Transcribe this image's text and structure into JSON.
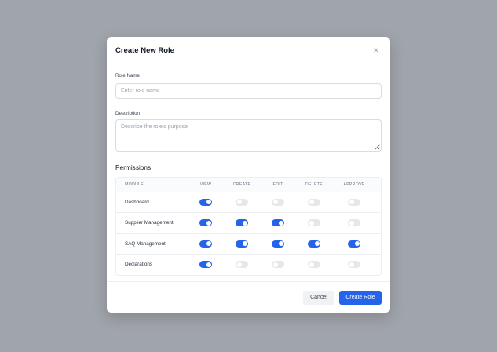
{
  "modal": {
    "title": "Create New Role",
    "close_icon": "×"
  },
  "form": {
    "role_name_label": "Role Name",
    "role_name_placeholder": "Enter role name",
    "role_name_value": "",
    "description_label": "Description",
    "description_placeholder": "Describe the role's purpose",
    "description_value": ""
  },
  "permissions": {
    "title": "Permissions",
    "columns": [
      "MODULE",
      "VIEW",
      "CREATE",
      "EDIT",
      "DELETE",
      "APPROVE"
    ],
    "rows": [
      {
        "module": "Dashboard",
        "view": true,
        "create": false,
        "edit": false,
        "delete": false,
        "approve": false
      },
      {
        "module": "Supplier Management",
        "view": true,
        "create": true,
        "edit": true,
        "delete": false,
        "approve": false
      },
      {
        "module": "SAQ Management",
        "view": true,
        "create": true,
        "edit": true,
        "delete": true,
        "approve": true
      },
      {
        "module": "Declarations",
        "view": true,
        "create": false,
        "edit": false,
        "delete": false,
        "approve": false
      }
    ]
  },
  "footer": {
    "cancel_label": "Cancel",
    "submit_label": "Create Role"
  },
  "colors": {
    "overlay": "#a0a4ab",
    "accent": "#2563eb",
    "toggle_off": "#e5e7eb"
  }
}
